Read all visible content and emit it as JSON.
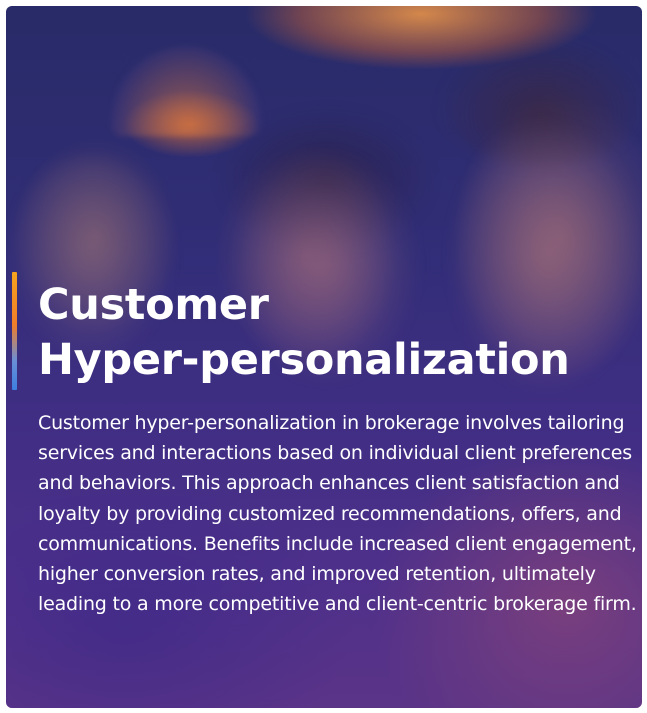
{
  "card": {
    "title": "Customer\nHyper-personalization",
    "description": "Customer hyper-personalization in brokerage involves tailoring services and interactions based on  individual client preferences and behaviors. This approach enhances client satisfaction and loyalty by providing customized recommendations, offers, and communications. Benefits include increased client engagement, higher conversion rates, and improved retention, ultimately leading to a more competitive and client-centric brokerage firm.",
    "background_image": "three-people-smiling-at-device-photo",
    "accent_colors": [
      "#f7a41d",
      "#ef7d2a",
      "#3d7fe0"
    ],
    "overlay_color": "#2a2d6a"
  }
}
